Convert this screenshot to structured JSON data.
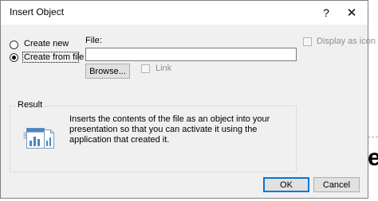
{
  "background": {
    "glyph": "e"
  },
  "dialog": {
    "title": "Insert Object",
    "help_symbol": "?",
    "close_symbol": "✕",
    "accent_color": "#0078d7"
  },
  "options": {
    "create_new": {
      "label": "Create new",
      "checked": false
    },
    "create_from_file": {
      "label": "Create from file",
      "checked": true
    }
  },
  "file": {
    "label": "File:",
    "value": "",
    "browse_label": "Browse...",
    "link_label": "Link",
    "link_checked": false
  },
  "display_as_icon": {
    "label": "Display as icon",
    "checked": false
  },
  "result": {
    "legend": "Result",
    "text": "Inserts the contents of the file as an object into your presentation so that you can activate it using the application that created it.",
    "icon": "embedded-chart-document-icon"
  },
  "footer": {
    "ok_label": "OK",
    "cancel_label": "Cancel"
  }
}
